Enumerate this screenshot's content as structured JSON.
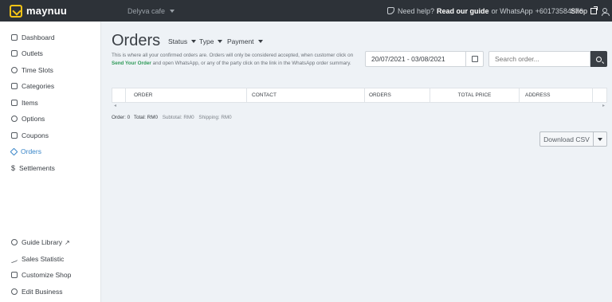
{
  "topbar": {
    "logo_text": "maynuu",
    "shop_name": "Delyva cafe",
    "help_prefix": "Need help?",
    "help_guide": "Read our guide",
    "help_or": "or WhatsApp",
    "help_phone": "+60173584876",
    "shop_link": "Shop"
  },
  "sidebar": {
    "items": [
      {
        "label": "Dashboard",
        "icon": "home-icon"
      },
      {
        "label": "Outlets",
        "icon": "store-icon"
      },
      {
        "label": "Time Slots",
        "icon": "clock-icon"
      },
      {
        "label": "Categories",
        "icon": "tag-icon"
      },
      {
        "label": "Items",
        "icon": "box-icon"
      },
      {
        "label": "Options",
        "icon": "options-icon"
      },
      {
        "label": "Coupons",
        "icon": "coupon-icon"
      },
      {
        "label": "Orders",
        "icon": "cube-icon",
        "active": true
      },
      {
        "label": "Settlements",
        "icon": "dollar-icon"
      }
    ],
    "bottom_items": [
      {
        "label": "Guide Library",
        "icon": "help-icon"
      },
      {
        "label": "Sales Statistic",
        "icon": "chart-line-icon"
      },
      {
        "label": "Customize Shop",
        "icon": "brush-icon"
      },
      {
        "label": "Edit Business",
        "icon": "gear-icon"
      }
    ]
  },
  "main": {
    "title": "Orders",
    "filters": {
      "status": "Status",
      "type": "Type",
      "payment": "Payment"
    },
    "description_1": "This is where all your confirmed orders are. Orders will only be considered accepted, when customer click on",
    "description_highlight": "Send Your Order",
    "description_2": "and open WhatsApp, or any of the party click on the link in the WhatsApp order summary.",
    "date_range": "20/07/2021 - 03/08/2021",
    "search_placeholder": "Search order...",
    "table_headers": [
      "ORDER",
      "CONTACT",
      "ORDERS",
      "TOTAL PRICE",
      "ADDRESS"
    ],
    "summary": {
      "order": "Order: 0",
      "total": "Total: RM0",
      "subtotal": "Subtotal: RM0",
      "shipping": "Shipping: RM0"
    },
    "download_csv": "Download CSV"
  },
  "colors": {
    "topbar": "#2d3238",
    "brand": "#f3c316",
    "active": "#3a86c8",
    "highlight": "#2f9a58"
  }
}
